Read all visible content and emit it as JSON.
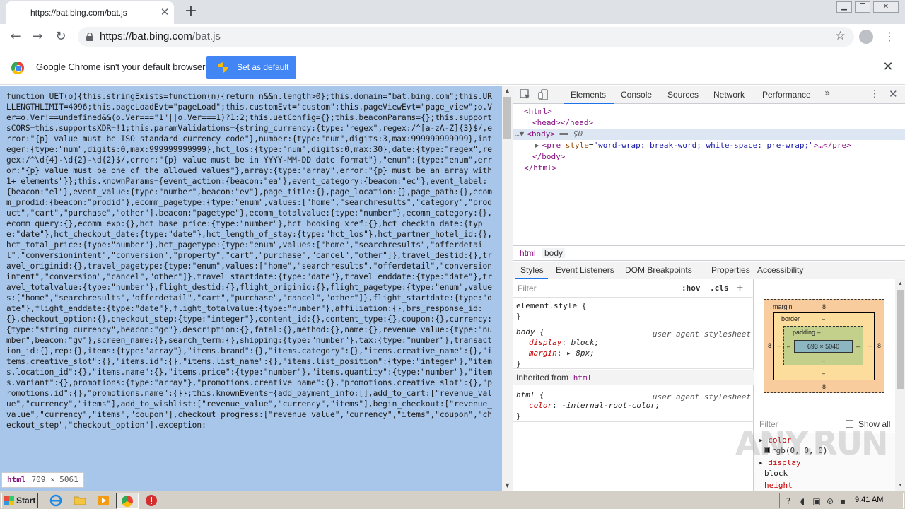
{
  "browser": {
    "tab_title": "https://bat.bing.com/bat.js",
    "url_host": "https://bat.bing.com",
    "url_path": "/bat.js"
  },
  "infobar": {
    "message": "Google Chrome isn't your default browser",
    "button_label": "Set as default"
  },
  "page": {
    "content": "function UET(o){this.stringExists=function(n){return n&&n.length>0};this.domain=\"bat.bing.com\";this.URLLENGTHLIMIT=4096;this.pageLoadEvt=\"pageLoad\";this.customEvt=\"custom\";this.pageViewEvt=\"page_view\";o.Ver=o.Ver!==undefined&&(o.Ver===\"1\"||o.Ver===1)?1:2;this.uetConfig={};this.beaconParams={};this.supportsCORS=this.supportsXDR=!1;this.paramValidations={string_currency:{type:\"regex\",regex:/^[a-zA-Z]{3}$/,error:\"{p} value must be ISO standard currency code\"},number:{type:\"num\",digits:3,max:999999999999},integer:{type:\"num\",digits:0,max:999999999999},hct_los:{type:\"num\",digits:0,max:30},date:{type:\"regex\",regex:/^\\d{4}-\\d{2}-\\d{2}$/,error:\"{p} value must be in YYYY-MM-DD date format\"},\"enum\":{type:\"enum\",error:\"{p} value must be one of the allowed values\"},array:{type:\"array\",error:\"{p} must be an array with 1+ elements\"}};this.knownParams={event_action:{beacon:\"ea\"},event_category:{beacon:\"ec\"},event_label:{beacon:\"el\"},event_value:{type:\"number\",beacon:\"ev\"},page_title:{},page_location:{},page_path:{},ecomm_prodid:{beacon:\"prodid\"},ecomm_pagetype:{type:\"enum\",values:[\"home\",\"searchresults\",\"category\",\"product\",\"cart\",\"purchase\",\"other\"],beacon:\"pagetype\"},ecomm_totalvalue:{type:\"number\"},ecomm_category:{},ecomm_query:{},ecomm_exp:{},hct_base_price:{type:\"number\"},hct_booking_xref:{},hct_checkin_date:{type:\"date\"},hct_checkout_date:{type:\"date\"},hct_length_of_stay:{type:\"hct_los\"},hct_partner_hotel_id:{},hct_total_price:{type:\"number\"},hct_pagetype:{type:\"enum\",values:[\"home\",\"searchresults\",\"offerdetail\",\"conversionintent\",\"conversion\",\"property\",\"cart\",\"purchase\",\"cancel\",\"other\"]},travel_destid:{},travel_originid:{},travel_pagetype:{type:\"enum\",values:[\"home\",\"searchresults\",\"offerdetail\",\"conversionintent\",\"conversion\",\"cancel\",\"other\"]},travel_startdate:{type:\"date\"},travel_enddate:{type:\"date\"},travel_totalvalue:{type:\"number\"},flight_destid:{},flight_originid:{},flight_pagetype:{type:\"enum\",values:[\"home\",\"searchresults\",\"offerdetail\",\"cart\",\"purchase\",\"cancel\",\"other\"]},flight_startdate:{type:\"date\"},flight_enddate:{type:\"date\"},flight_totalvalue:{type:\"number\"},affiliation:{},brs_response_id:{},checkout_option:{},checkout_step:{type:\"integer\"},content_id:{},content_type:{},coupon:{},currency:{type:\"string_currency\",beacon:\"gc\"},description:{},fatal:{},method:{},name:{},revenue_value:{type:\"number\",beacon:\"gv\"},screen_name:{},search_term:{},shipping:{type:\"number\"},tax:{type:\"number\"},transaction_id:{},rep:{},items:{type:\"array\"},\"items.brand\":{},\"items.category\":{},\"items.creative_name\":{},\"items.creative_slot\":{},\"items.id\":{},\"items.list_name\":{},\"items.list_position\":{type:\"integer\"},\"items.location_id\":{},\"items.name\":{},\"items.price\":{type:\"number\"},\"items.quantity\":{type:\"number\"},\"items.variant\":{},promotions:{type:\"array\"},\"promotions.creative_name\":{},\"promotions.creative_slot\":{},\"promotions.id\":{},\"promotions.name\":{}};this.knownEvents={add_payment_info:[],add_to_cart:[\"revenue_value\",\"currency\",\"items\"],add_to_wishlist:[\"revenue_value\",\"currency\",\"items\"],begin_checkout:[\"revenue_value\",\"currency\",\"items\",\"coupon\"],checkout_progress:[\"revenue_value\",\"currency\",\"items\",\"coupon\",\"checkout_step\",\"checkout_option\"],exception:"
  },
  "tooltip": {
    "tag": "html",
    "dims": "709 × 5061"
  },
  "devtools": {
    "tabs": [
      "Elements",
      "Console",
      "Sources",
      "Network",
      "Performance"
    ],
    "more": "»",
    "dom": {
      "html_open": "<html>",
      "head": "<head></head>",
      "body_open": "<body>",
      "body_sel": "== $0",
      "pre_tag": "<pre",
      "pre_attr": "style",
      "pre_val": "\"word-wrap: break-word; white-space: pre-wrap;\"",
      "pre_rest": ">…</pre>",
      "body_close": "</body>",
      "html_close": "</html>"
    },
    "breadcrumbs": [
      "html",
      "body"
    ],
    "subtabs": [
      "Styles",
      "Event Listeners",
      "DOM Breakpoints",
      "Properties",
      "Accessibility"
    ],
    "styles": {
      "filter_placeholder": "Filter",
      "hov": ":hov",
      "cls": ".cls",
      "plus": "+",
      "element_style": "element.style {",
      "close_brace": "}",
      "body_selector": "body {",
      "ua_label": "user agent stylesheet",
      "display_prop": "display",
      "display_val": "block;",
      "margin_prop": "margin",
      "margin_val": "▸ 8px;",
      "inherited_label": "Inherited from",
      "inherited_tag": "html",
      "html_selector": "html {",
      "color_prop": "color",
      "color_val": "-internal-root-color;"
    },
    "boxmodel": {
      "margin_label": "margin",
      "margin_value": "8",
      "border_label": "border",
      "border_value": "–",
      "padding_label": "padding –",
      "dash": "–",
      "content": "693 × 5040"
    },
    "computed": {
      "filter_placeholder": "Filter",
      "show_all": "Show all",
      "color_prop": "color",
      "color_val": "rgb(0, 0, 0)",
      "display_prop": "display",
      "display_val": "block",
      "height_prop": "height"
    }
  },
  "taskbar": {
    "start": "Start",
    "clock": "9:41 AM"
  },
  "colors": {
    "selection": "#a8c6ea",
    "accent": "#1a73e8",
    "button_blue": "#4285f4"
  }
}
